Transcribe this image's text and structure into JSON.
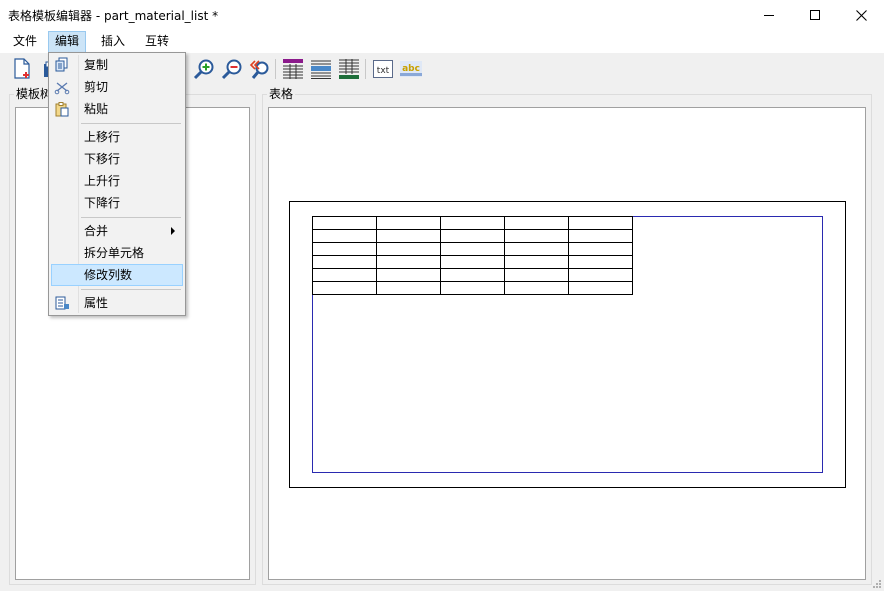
{
  "window": {
    "title": "表格模板编辑器 - part_material_list *",
    "minimize_icon": "minimize-icon",
    "maximize_icon": "maximize-icon",
    "close_icon": "close-icon"
  },
  "menubar": {
    "items": [
      {
        "label": "文件",
        "active": false
      },
      {
        "label": "编辑",
        "active": true
      },
      {
        "label": "插入",
        "active": false
      },
      {
        "label": "互转",
        "active": false
      }
    ]
  },
  "toolbar": {
    "icons": [
      "new-file-icon",
      "open-file-icon",
      "zoom-in-icon",
      "zoom-out-icon",
      "zoom-reset-icon",
      "table-style-purple-icon",
      "table-style-blue-icon",
      "table-style-green-icon",
      "txt-icon",
      "abc-icon"
    ]
  },
  "left_panel": {
    "label": "模板树"
  },
  "right_panel": {
    "label": "表格"
  },
  "edit_menu": {
    "items": [
      {
        "label": "复制",
        "icon": "copy-icon"
      },
      {
        "label": "剪切",
        "icon": "cut-icon"
      },
      {
        "label": "粘贴",
        "icon": "paste-icon"
      },
      {
        "label": "上移行"
      },
      {
        "label": "下移行"
      },
      {
        "label": "上升行"
      },
      {
        "label": "下降行"
      },
      {
        "label": "合并",
        "submenu": true
      },
      {
        "label": "拆分单元格"
      },
      {
        "label": "修改列数",
        "highlighted": true
      },
      {
        "label": "属性",
        "icon": "properties-icon"
      }
    ]
  },
  "table_preview": {
    "rows": 6,
    "columns": 5,
    "colors": {
      "outer_border": "#000000",
      "inner_border": "#2a2ab0"
    }
  }
}
